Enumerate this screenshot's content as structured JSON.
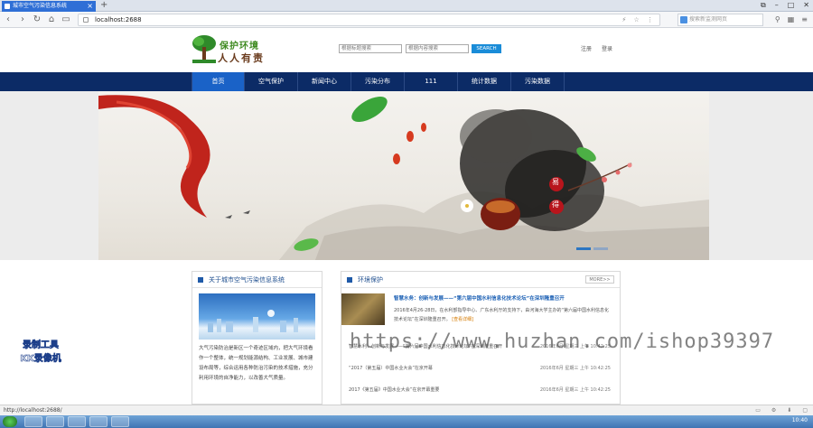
{
  "browser": {
    "tab_title": "城市空气污染信息系统",
    "new_tab": "+",
    "url": "localhost:2688",
    "url_tools": "⚡ ☆ ⋮",
    "search_placeholder": "搜索新监测网页",
    "window_buttons": [
      "⧉",
      "–",
      "□",
      "✕"
    ],
    "nav_buttons": [
      "‹",
      "›",
      "↻",
      "⌂",
      "▭"
    ],
    "right_icons": [
      "⚲",
      "▦",
      "≡"
    ],
    "status_text": "http://localhost:2688/"
  },
  "header": {
    "logo_line1": "保护环境",
    "logo_line2": "人人有责",
    "search1_placeholder": "根据标题搜索",
    "search2_placeholder": "根据内容搜索",
    "search_button": "SEARCH",
    "register": "注册",
    "login": "登录"
  },
  "nav": {
    "items": [
      "首页",
      "空气保护",
      "新闻中心",
      "污染分布",
      "111",
      "统计数据",
      "污染数据"
    ],
    "active_index": 0
  },
  "banner": {
    "seal_text": [
      "易",
      "得"
    ],
    "slide_count": 2,
    "active_slide": 0
  },
  "about": {
    "title": "关于城市空气污染信息系统",
    "text": "大气污染防治是新区一个奇迹区域内，把大气环境看作一个整体，统一规划能源结构、工业发展、城市建设布局等，综合运用各种防治污染的技术措施，充分利用环境的自净能力，以改善大气质量。"
  },
  "env": {
    "title": "环境保护",
    "more": "MORE>>",
    "headline": "智慧水务：创新与发展——“第六届中国水利信息化技术论坛”在深圳隆重召开",
    "summary": "2016年4月26-28日，在水利部指导中心、广东水利厅的支持下，由河海大学主办的“第六届中国水利信息化技术论坛”在深圳隆重召开。",
    "detail_link": "[查看详细]",
    "list": [
      {
        "title": "智慧水利：创新与发展——“第六届中国水利信息化技术论坛”在深圳隆重召开",
        "date": "2016年6月 星期三 上午 10:42:25"
      },
      {
        "title": "“2017（第五届）中国水业大会”在京开幕",
        "date": "2016年6月 星期三 上午 10:42:25"
      },
      {
        "title": "2017《第五届》中国水业大会”在京开幕重要",
        "date": "2016年6月 星期三 上午 10:42:25"
      }
    ]
  },
  "overlay": {
    "watermark": "https://www.huzhan.com/ishop39397",
    "stamp_line1": "录制工具",
    "stamp_line2": "KK录像机"
  },
  "taskbar": {
    "clock": "10:40"
  },
  "colors": {
    "nav_bg": "#0c2b66",
    "nav_active": "#1a62c7",
    "link_blue": "#1a5fb4",
    "search_btn": "#1a8cd8"
  }
}
